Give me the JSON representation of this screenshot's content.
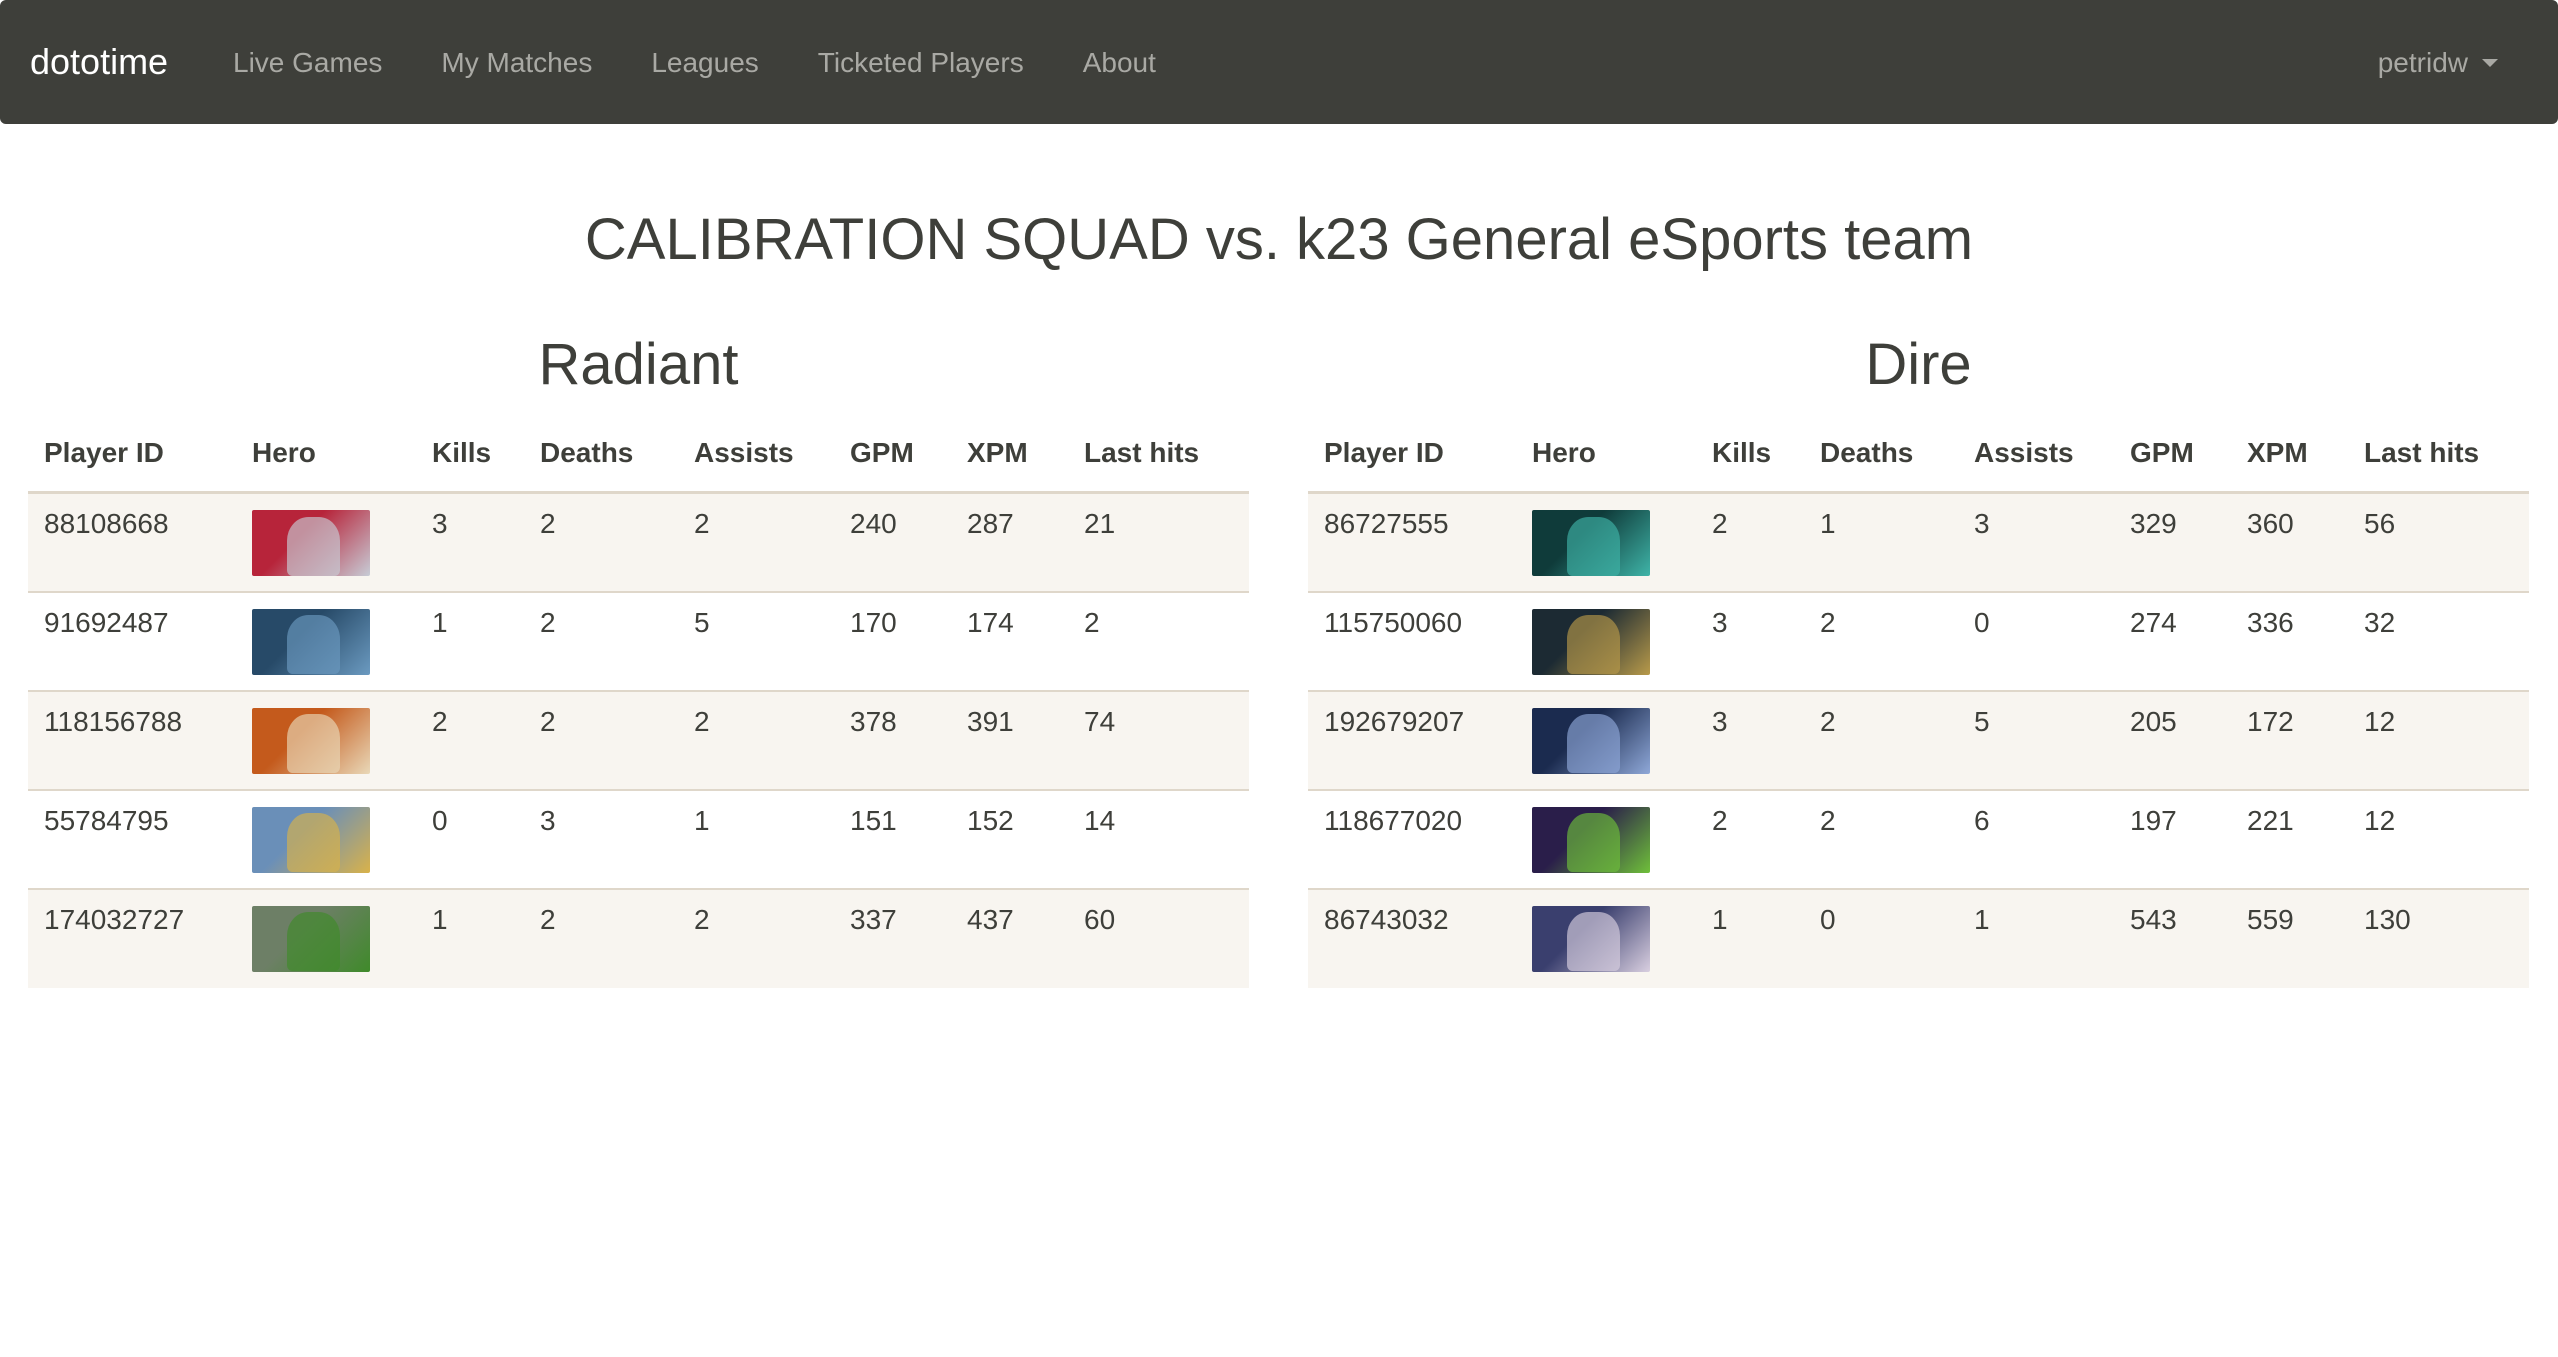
{
  "navbar": {
    "brand": "dototime",
    "links": [
      "Live Games",
      "My Matches",
      "Leagues",
      "Ticketed Players",
      "About"
    ],
    "user": "petridw"
  },
  "match": {
    "title": "CALIBRATION SQUAD vs. k23 General eSports team"
  },
  "columns": [
    "Player ID",
    "Hero",
    "Kills",
    "Deaths",
    "Assists",
    "GPM",
    "XPM",
    "Last hits"
  ],
  "radiant": {
    "name": "Radiant",
    "players": [
      {
        "id": "88108668",
        "kills": "3",
        "deaths": "2",
        "assists": "2",
        "gpm": "240",
        "xpm": "287",
        "last_hits": "21",
        "hero_colors": [
          "#b7243a",
          "#c7ccd6"
        ]
      },
      {
        "id": "91692487",
        "kills": "1",
        "deaths": "2",
        "assists": "5",
        "gpm": "170",
        "xpm": "174",
        "last_hits": "2",
        "hero_colors": [
          "#274a68",
          "#6b9ac0"
        ]
      },
      {
        "id": "118156788",
        "kills": "2",
        "deaths": "2",
        "assists": "2",
        "gpm": "378",
        "xpm": "391",
        "last_hits": "74",
        "hero_colors": [
          "#c45a1c",
          "#e9d8b8"
        ]
      },
      {
        "id": "55784795",
        "kills": "0",
        "deaths": "3",
        "assists": "1",
        "gpm": "151",
        "xpm": "152",
        "last_hits": "14",
        "hero_colors": [
          "#6a8fb8",
          "#d9b24a"
        ]
      },
      {
        "id": "174032727",
        "kills": "1",
        "deaths": "2",
        "assists": "2",
        "gpm": "337",
        "xpm": "437",
        "last_hits": "60",
        "hero_colors": [
          "#6d7f66",
          "#3f8a2a"
        ]
      }
    ]
  },
  "dire": {
    "name": "Dire",
    "players": [
      {
        "id": "86727555",
        "kills": "2",
        "deaths": "1",
        "assists": "3",
        "gpm": "329",
        "xpm": "360",
        "last_hits": "56",
        "hero_colors": [
          "#0f3b3a",
          "#3fb4a8"
        ]
      },
      {
        "id": "115750060",
        "kills": "3",
        "deaths": "2",
        "assists": "0",
        "gpm": "274",
        "xpm": "336",
        "last_hits": "32",
        "hero_colors": [
          "#1c2a33",
          "#b89a4a"
        ]
      },
      {
        "id": "192679207",
        "kills": "3",
        "deaths": "2",
        "assists": "5",
        "gpm": "205",
        "xpm": "172",
        "last_hits": "12",
        "hero_colors": [
          "#1b2b4f",
          "#8fa8d8"
        ]
      },
      {
        "id": "118677020",
        "kills": "2",
        "deaths": "2",
        "assists": "6",
        "gpm": "197",
        "xpm": "221",
        "last_hits": "12",
        "hero_colors": [
          "#2a1e4a",
          "#6fc03a"
        ]
      },
      {
        "id": "86743032",
        "kills": "1",
        "deaths": "0",
        "assists": "1",
        "gpm": "543",
        "xpm": "559",
        "last_hits": "130",
        "hero_colors": [
          "#3a3f6e",
          "#d9cfe0"
        ]
      }
    ]
  },
  "colors": {
    "navbar_bg": "#3e3f3a",
    "text": "#3e3f3a",
    "nav_link": "#a9a9a4",
    "stripe": "#f8f5f0",
    "border": "#dfd7ca"
  }
}
